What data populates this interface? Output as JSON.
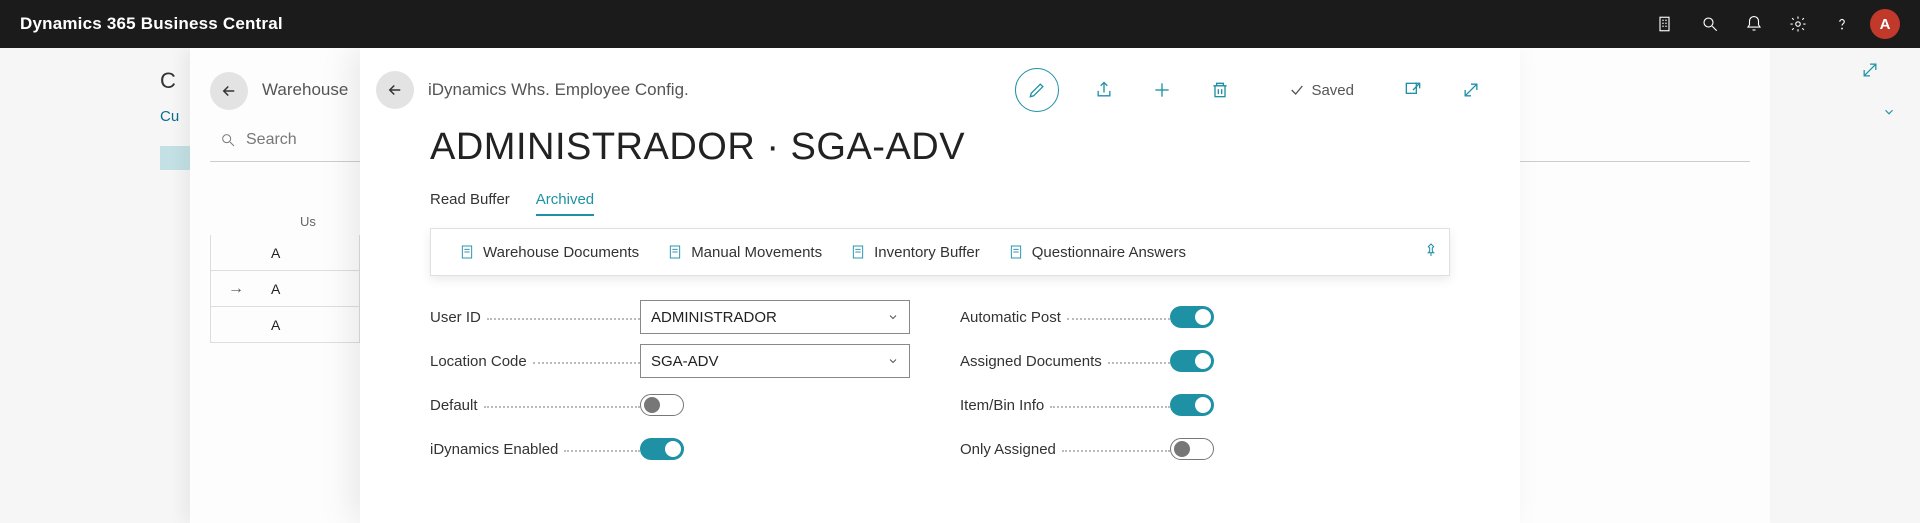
{
  "app": {
    "title": "Dynamics 365 Business Central",
    "avatar_letter": "A"
  },
  "bg": {
    "corner_letter": "C",
    "side_letter": "Cu"
  },
  "panel2": {
    "crumb": "Warehouse",
    "search_placeholder": "Search",
    "col_header": "Us",
    "rows": [
      "A",
      "A",
      "A"
    ]
  },
  "card": {
    "crumb": "iDynamics Whs. Employee Config.",
    "saved_label": "Saved",
    "title": "ADMINISTRADOR · SGA-ADV",
    "tabs": {
      "read_buffer": "Read Buffer",
      "archived": "Archived"
    },
    "actions": {
      "warehouse_documents": "Warehouse Documents",
      "manual_movements": "Manual Movements",
      "inventory_buffer": "Inventory Buffer",
      "questionnaire_answers": "Questionnaire Answers"
    },
    "fields": {
      "user_id": {
        "label": "User ID",
        "value": "ADMINISTRADOR"
      },
      "location_code": {
        "label": "Location Code",
        "value": "SGA-ADV"
      },
      "default": {
        "label": "Default",
        "value": false
      },
      "idynamics_enabled": {
        "label": "iDynamics Enabled",
        "value": true
      },
      "automatic_post": {
        "label": "Automatic Post",
        "value": true
      },
      "assigned_documents": {
        "label": "Assigned Documents",
        "value": true
      },
      "item_bin_info": {
        "label": "Item/Bin Info",
        "value": true
      },
      "only_assigned": {
        "label": "Only Assigned",
        "value": false
      }
    }
  }
}
